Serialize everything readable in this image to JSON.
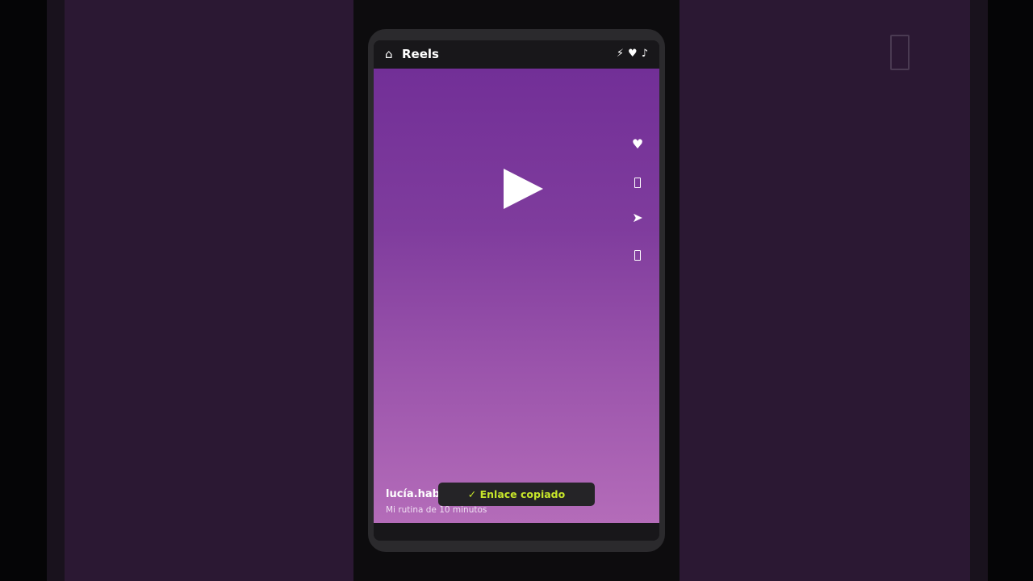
{
  "topbar": {
    "home_icon": "⌂",
    "title": "Reels",
    "icons": [
      "⚡",
      "♥",
      "♪"
    ]
  },
  "video": {
    "play_icon": "play-icon"
  },
  "actions": {
    "like_icon": "♥",
    "share_icon": "➤"
  },
  "post": {
    "author": "lucía.hab",
    "caption": "Mi rutina de 10 minutos"
  },
  "toast": {
    "message": "✓ Enlace copiado"
  },
  "colors": {
    "accent": "#c7e62a",
    "gradient_top": "#722f97",
    "gradient_bottom": "#b46cb9"
  }
}
